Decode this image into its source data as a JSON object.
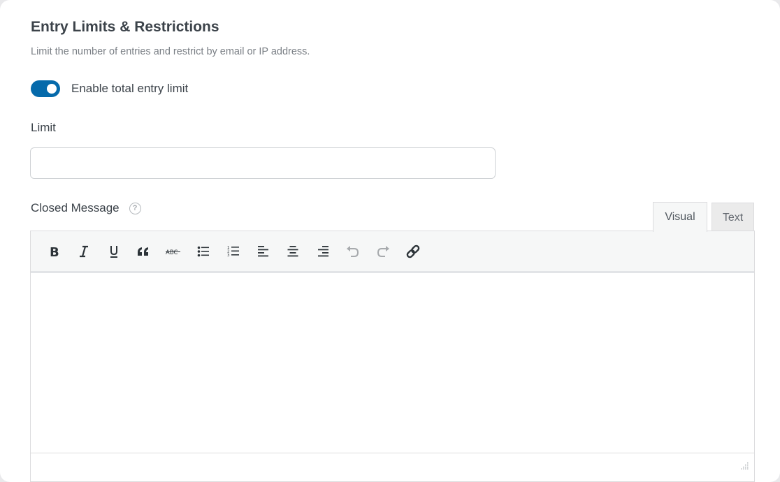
{
  "section": {
    "title": "Entry Limits & Restrictions",
    "description": "Limit the number of entries and restrict by email or IP address."
  },
  "toggle": {
    "label": "Enable total entry limit",
    "enabled": true,
    "color": "#056aab"
  },
  "limit_field": {
    "label": "Limit",
    "value": "",
    "placeholder": ""
  },
  "closed_message": {
    "label": "Closed Message",
    "help_icon": "question-circle-icon",
    "help_glyph": "?",
    "tabs": [
      {
        "label": "Visual",
        "active": true
      },
      {
        "label": "Text",
        "active": false
      }
    ],
    "toolbar": [
      {
        "name": "bold",
        "icon": "bold-icon",
        "label": "B"
      },
      {
        "name": "italic",
        "icon": "italic-icon",
        "label": "I"
      },
      {
        "name": "underline",
        "icon": "underline-icon",
        "label": "U"
      },
      {
        "name": "blockquote",
        "icon": "blockquote-icon",
        "label": "“"
      },
      {
        "name": "strikethrough",
        "icon": "strikethrough-icon",
        "label": "ABC"
      },
      {
        "name": "bulleted-list",
        "icon": "bulleted-list-icon"
      },
      {
        "name": "numbered-list",
        "icon": "numbered-list-icon"
      },
      {
        "name": "align-left",
        "icon": "align-left-icon"
      },
      {
        "name": "align-center",
        "icon": "align-center-icon"
      },
      {
        "name": "align-right",
        "icon": "align-right-icon"
      },
      {
        "name": "undo",
        "icon": "undo-icon",
        "disabled": true
      },
      {
        "name": "redo",
        "icon": "redo-icon",
        "disabled": true
      },
      {
        "name": "link",
        "icon": "link-icon"
      }
    ],
    "content": ""
  }
}
